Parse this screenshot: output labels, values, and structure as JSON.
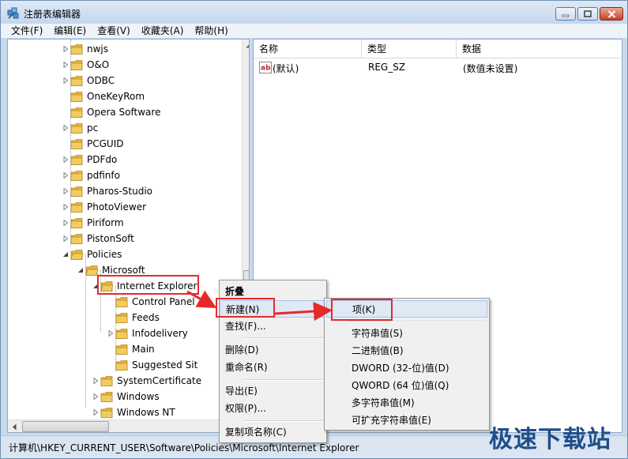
{
  "window": {
    "title": "注册表编辑器",
    "menu": [
      "文件(F)",
      "编辑(E)",
      "查看(V)",
      "收藏夹(A)",
      "帮助(H)"
    ]
  },
  "tree": {
    "items": [
      {
        "label": "nwjs",
        "expandable": true
      },
      {
        "label": "O&O",
        "expandable": true
      },
      {
        "label": "ODBC",
        "expandable": true
      },
      {
        "label": "OneKeyRom",
        "expandable": false
      },
      {
        "label": "Opera Software",
        "expandable": false
      },
      {
        "label": "pc",
        "expandable": true
      },
      {
        "label": "PCGUID",
        "expandable": false
      },
      {
        "label": "PDFdo",
        "expandable": true
      },
      {
        "label": "pdfinfo",
        "expandable": true
      },
      {
        "label": "Pharos-Studio",
        "expandable": true
      },
      {
        "label": "PhotoViewer",
        "expandable": true
      },
      {
        "label": "Piriform",
        "expandable": true
      },
      {
        "label": "PistonSoft",
        "expandable": true
      },
      {
        "label": "Policies",
        "expandable": true,
        "expanded": true
      },
      {
        "label": "Microsoft",
        "expandable": true,
        "expanded": true
      },
      {
        "label": "Internet Explorer",
        "expandable": true,
        "expanded": true,
        "selected": true
      },
      {
        "label": "Control Panel",
        "expandable": false
      },
      {
        "label": "Feeds",
        "expandable": false
      },
      {
        "label": "Infodelivery",
        "expandable": true
      },
      {
        "label": "Main",
        "expandable": false
      },
      {
        "label": "Suggested Sit",
        "expandable": false
      },
      {
        "label": "SystemCertificate",
        "expandable": true
      },
      {
        "label": "Windows",
        "expandable": true
      },
      {
        "label": "Windows NT",
        "expandable": true
      }
    ]
  },
  "values": {
    "columns": [
      "名称",
      "类型",
      "数据"
    ],
    "rows": [
      {
        "name": "(默认)",
        "type": "REG_SZ",
        "data": "(数值未设置)"
      }
    ]
  },
  "context_menu": {
    "items": [
      "折叠",
      "新建(N)",
      "查找(F)...",
      "删除(D)",
      "重命名(R)",
      "导出(E)",
      "权限(P)...",
      "复制项名称(C)"
    ]
  },
  "submenu": {
    "items": [
      "项(K)",
      "字符串值(S)",
      "二进制值(B)",
      "DWORD (32-位)值(D)",
      "QWORD (64 位)值(Q)",
      "多字符串值(M)",
      "可扩充字符串值(E)"
    ]
  },
  "statusbar": {
    "path": "计算机\\HKEY_CURRENT_USER\\Software\\Policies\\Microsoft\\Internet Explorer"
  },
  "watermark": "极速下载站",
  "colors": {
    "highlight_red": "#e62a2a",
    "folder_yellow": "#f2cc5f",
    "window_frame": "#c9daed"
  }
}
